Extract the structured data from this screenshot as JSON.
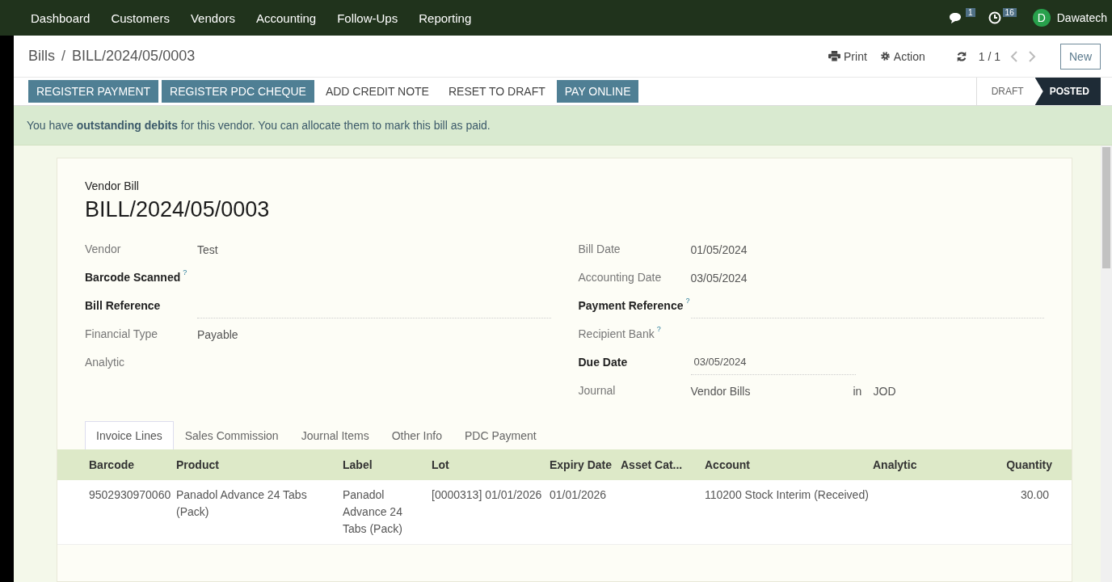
{
  "menu": [
    "Dashboard",
    "Customers",
    "Vendors",
    "Accounting",
    "Follow-Ups",
    "Reporting"
  ],
  "systray": {
    "messages_count": "1",
    "activities_count": "16",
    "avatar_letter": "D",
    "user": "Dawatech"
  },
  "breadcrumb": {
    "parent": "Bills",
    "separator": "/",
    "current": "BILL/2024/05/0003"
  },
  "control": {
    "print": "Print",
    "action": "Action",
    "pager": "1 / 1",
    "new": "New"
  },
  "buttons": [
    {
      "label": "REGISTER PAYMENT",
      "kind": "primary"
    },
    {
      "label": "REGISTER PDC CHEQUE",
      "kind": "primary"
    },
    {
      "label": "ADD CREDIT NOTE",
      "kind": "secondary"
    },
    {
      "label": "RESET TO DRAFT",
      "kind": "secondary"
    },
    {
      "label": "PAY ONLINE",
      "kind": "primary"
    }
  ],
  "status_bar": [
    {
      "label": "DRAFT",
      "selected": false
    },
    {
      "label": "POSTED",
      "selected": true
    }
  ],
  "banner": "You have **outstanding debits** for this vendor. You can allocate them to mark this bill as paid.",
  "form": {
    "type": "Vendor Bill",
    "name": "BILL/2024/05/0003",
    "left_fields": [
      {
        "label": "Vendor",
        "required": false,
        "kind": "text",
        "value": "Test"
      },
      {
        "label": "Barcode Scanned",
        "required": true,
        "help": "?",
        "kind": "text"
      },
      {
        "label": "Bill Reference",
        "required": true,
        "kind": "input"
      },
      {
        "label": "Financial Type",
        "required": false,
        "kind": "text",
        "value": "Payable"
      },
      {
        "label": "Analytic",
        "required": false,
        "kind": "text"
      }
    ],
    "right_fields": [
      {
        "label": "Bill Date",
        "required": false,
        "kind": "text",
        "value": "01/05/2024"
      },
      {
        "label": "Accounting Date",
        "required": false,
        "kind": "text",
        "value": "03/05/2024"
      },
      {
        "label": "Payment Reference",
        "required": true,
        "help": "?",
        "kind": "input"
      },
      {
        "label": "Recipient Bank",
        "required": false,
        "help": "?",
        "kind": "text"
      },
      {
        "label": "Due Date",
        "required": true,
        "kind": "input",
        "value": "03/05/2024"
      },
      {
        "label": "Journal",
        "required": false,
        "kind": "journal",
        "value": "Vendor Bills",
        "joiner": "in",
        "currency": "JOD"
      }
    ]
  },
  "tabs": [
    {
      "label": "Invoice Lines",
      "selected": true
    },
    {
      "label": "Sales Commission",
      "selected": false
    },
    {
      "label": "Journal Items",
      "selected": false
    },
    {
      "label": "Other Info",
      "selected": false
    },
    {
      "label": "PDC Payment",
      "selected": false
    }
  ],
  "table": {
    "columns": [
      "Barcode",
      "Product",
      "Label",
      "Lot",
      "Expiry Date",
      "Asset Cat...",
      "Account",
      "Analytic",
      "Quantity"
    ],
    "rows": [
      [
        "9502930970060",
        "Panadol Advance 24 Tabs (Pack)",
        "Panadol Advance 24 Tabs (Pack)",
        "[0000313] 01/01/2026",
        "01/01/2026",
        "",
        "110200 Stock Interim (Received)",
        "",
        "30.00"
      ]
    ]
  }
}
